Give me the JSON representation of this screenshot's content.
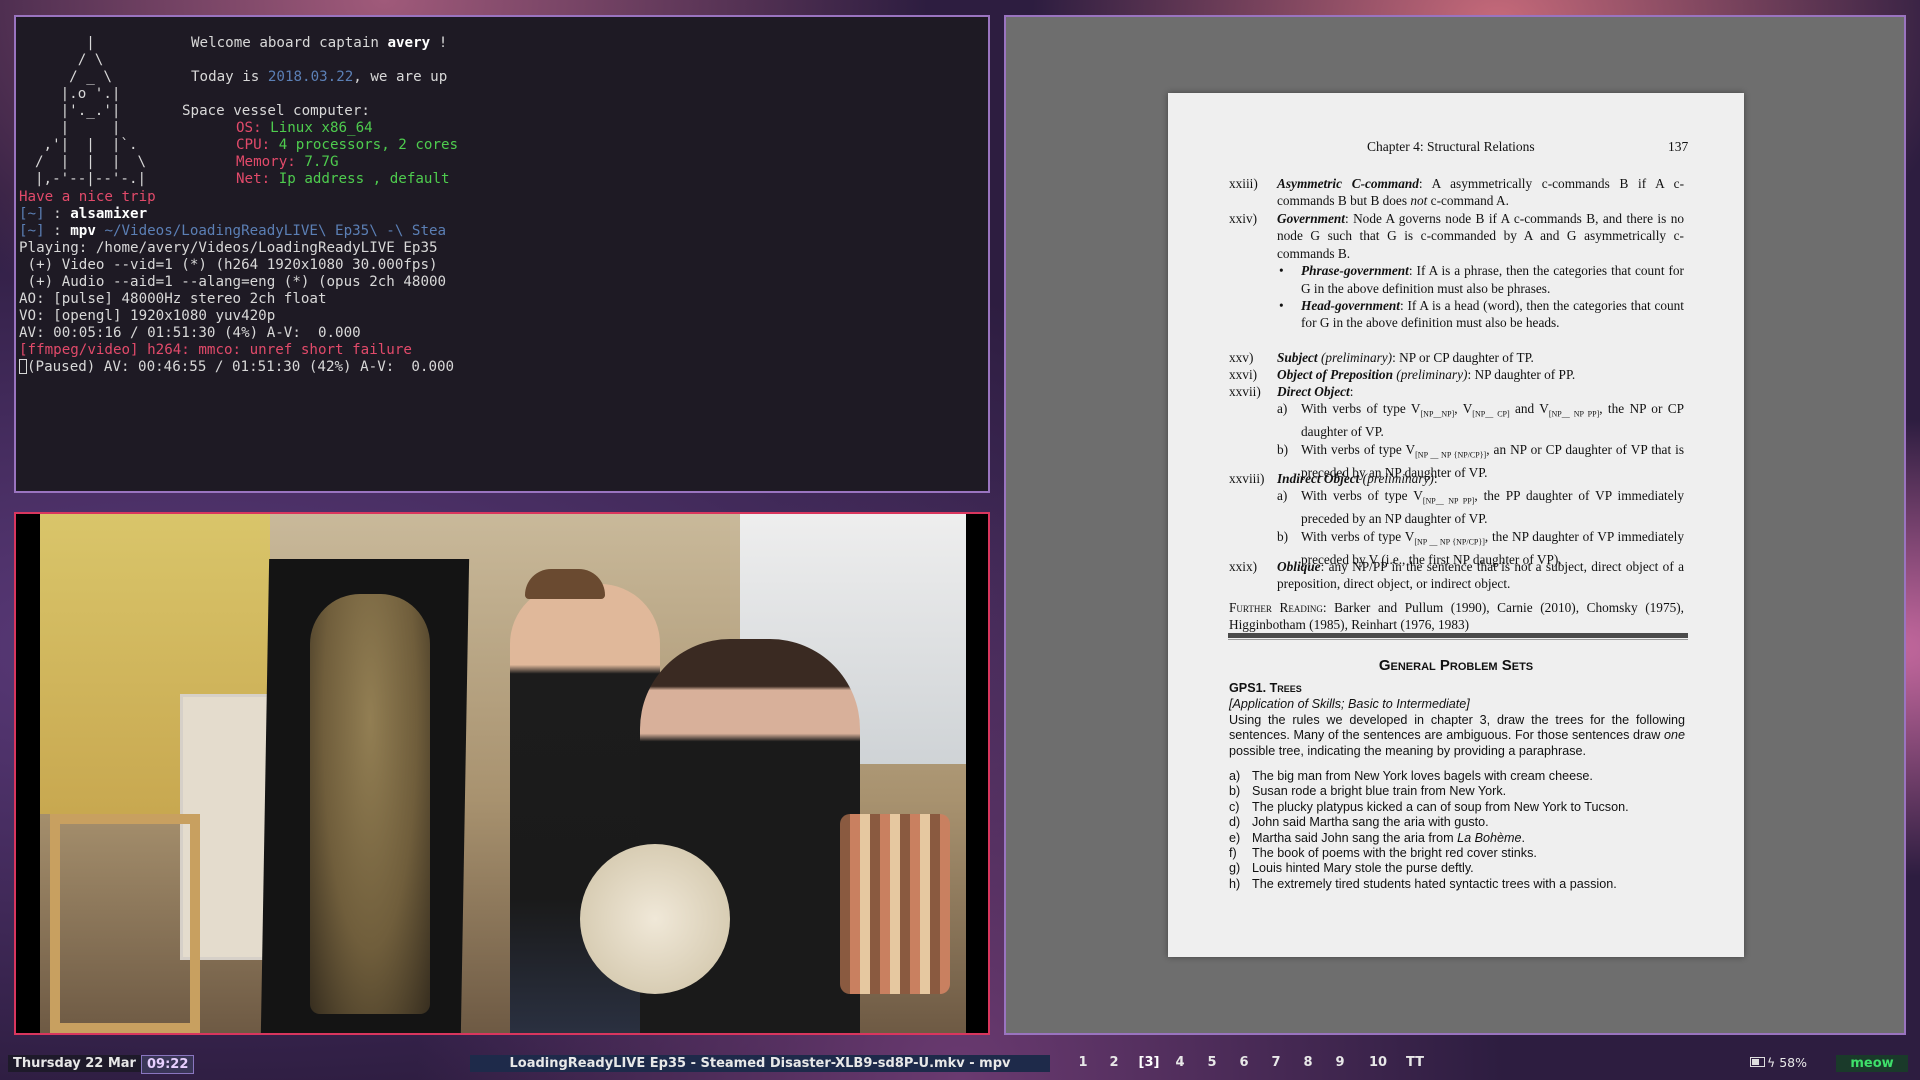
{
  "terminal": {
    "ascii_art": [
      "      |",
      "     / \\",
      "    / _ \\",
      "   |.o '.|",
      "   |'._.'|",
      "   |     |",
      " ,'|  |  |`.",
      "/  |  |  |  \\",
      "|,-'--|--'-.|"
    ],
    "welcome_prefix": "Welcome aboard captain ",
    "captain": "avery",
    "welcome_suffix": " !",
    "today_prefix": "Today is ",
    "today_date": "2018.03.22",
    "today_suffix": ", we are up",
    "computer_label": "Space vessel computer:",
    "os_label": "OS:",
    "os_value": " Linux x86_64",
    "cpu_label": "CPU:",
    "cpu_value": " 4 processors, 2 cores",
    "mem_label": "Memory:",
    "mem_value": " 7.7G",
    "net_label": "Net:",
    "net_value": " Ip address , default",
    "nice_trip": "Have a nice trip",
    "prompt1_dir": "[~] ",
    "prompt1_sep": ": ",
    "prompt1_cmd": "alsamixer",
    "prompt2_dir": "[~] ",
    "prompt2_sep": ": ",
    "prompt2_cmd": "mpv ",
    "prompt2_arg": "~/Videos/LoadingReadyLIVE\\ Ep35\\ -\\ Stea",
    "out_playing": "Playing: /home/avery/Videos/LoadingReadyLIVE Ep35",
    "out_video": " (+) Video --vid=1 (*) (h264 1920x1080 30.000fps)",
    "out_audio": " (+) Audio --aid=1 --alang=eng (*) (opus 2ch 48000",
    "out_ao": "AO: [pulse] 48000Hz stereo 2ch float",
    "out_vo": "VO: [opengl] 1920x1080 yuv420p",
    "out_av": "AV: 00:05:16 / 01:51:30 (4%) A-V:  0.000",
    "out_err": "[ffmpeg/video] h264: mmco: unref short failure",
    "out_paused": "(Paused) AV: 00:46:55 / 01:51:30 (42%) A-V:  0.000"
  },
  "video": {
    "description_name": "mpv-video-frame"
  },
  "pdf": {
    "chapter_title": "Chapter 4: Structural Relations",
    "page_number": "137",
    "entries": [
      {
        "num": "xxiii)",
        "term": "Asymmetric C-command",
        "text_a": ": A asymmetrically c-commands B if A c-commands B but B does ",
        "text_em": "not",
        "text_b": " c-command A."
      },
      {
        "num": "xxiv)",
        "term": "Government",
        "text": ": Node A governs node B if A c-commands B, and there is no node G such that G is c-commanded by A and G asymmetrically c-commands B."
      },
      {
        "bullet": "•",
        "term": "Phrase-government",
        "text": ": If A is a phrase, then the categories that count for G in the above definition must also be phrases."
      },
      {
        "bullet": "•",
        "term": "Head-government",
        "text": ": If A is a head (word), then the categories that count for G in the above definition must also be heads."
      },
      {
        "num": "xxv)",
        "term": "Subject",
        "qual": " (preliminary)",
        "text": ": NP or CP daughter of TP."
      },
      {
        "num": "xxvi)",
        "term": "Object of Preposition",
        "qual": " (preliminary)",
        "text": ": NP daughter of PP."
      },
      {
        "num": "xxvii)",
        "term": "Direct Object",
        "text": ":"
      },
      {
        "mark": "a)",
        "text_a": "With verbs of type V",
        "sub1": "[NP__NP]",
        "text_b": ", V",
        "sub2": "[NP__ CP]",
        "text_c": " and V",
        "sub3": "[NP__ NP PP]",
        "text_d": ", the NP or CP daughter of VP."
      },
      {
        "mark": "b)",
        "text_a": "With verbs of type V",
        "sub1": "[NP __ NP {NP/CP}]",
        "text_b": ", an NP or CP daughter of VP that is preceded by an NP daughter of VP."
      },
      {
        "num": "xxviii)",
        "term": "Indirect Object",
        "qual": " (preliminary)",
        "text": ":"
      },
      {
        "mark": "a)",
        "text_a": "With verbs of type V",
        "sub1": "[NP__ NP PP]",
        "text_b": ", the PP daughter of VP immediately preceded by an NP daughter of VP."
      },
      {
        "mark": "b)",
        "text_a": "With verbs of type V",
        "sub1": "[NP __ NP {NP/CP}]",
        "text_b": ", the NP daughter of VP immediately preceded by V (i.e., the first NP daughter of VP)."
      },
      {
        "num": "xxix)",
        "term": "Oblique",
        "text": ": any NP/PP in the sentence that is not a subject, direct object of a preposition, direct object, or indirect object."
      }
    ],
    "further_label": "Further Reading",
    "further_text": ": Barker and Pullum (1990), Carnie (2010), Chomsky (1975), Higginbotham (1985), Reinhart (1976, 1983)",
    "gps_title": "General Problem Sets",
    "gps1_title": "GPS1. Trees",
    "gps1_sub": "[Application of Skills; Basic to Intermediate]",
    "gps1_intro_a": "Using the rules we developed in chapter 3, draw the trees for the following sentences. Many of the sentences are ambiguous. For those sentences draw ",
    "gps1_intro_em": "one",
    "gps1_intro_b": " possible tree, indicating the meaning by providing a paraphrase.",
    "problems": [
      {
        "m": "a)",
        "t": "The big man from New York loves bagels with cream cheese."
      },
      {
        "m": "b)",
        "t": "Susan rode a bright blue train from New York."
      },
      {
        "m": "c)",
        "t": "The plucky platypus kicked a can of soup from New York to Tucson."
      },
      {
        "m": "d)",
        "t": "John said Martha sang the aria with gusto."
      },
      {
        "m": "e)",
        "t": "Martha said John sang the aria from ",
        "em": "La Bohème",
        "t2": "."
      },
      {
        "m": "f)",
        "t": "The book of poems with the bright red cover stinks."
      },
      {
        "m": "g)",
        "t": "Louis hinted Mary stole the purse deftly."
      },
      {
        "m": "h)",
        "t": "The extremely tired students hated syntactic trees with a passion."
      }
    ]
  },
  "statusbar": {
    "date": "Thursday 22 Mar",
    "time": "09:22",
    "window_title": "LoadingReadyLIVE Ep35 - Steamed Disaster-XLB9-sd8P-U.mkv - mpv",
    "workspaces": [
      "1",
      "2",
      "[3]",
      "4",
      "5",
      "6",
      "7",
      "8",
      "9",
      "10"
    ],
    "layout": "TT",
    "battery": "58%",
    "battery_icon": "battery-charging-icon",
    "meow": "meow"
  }
}
